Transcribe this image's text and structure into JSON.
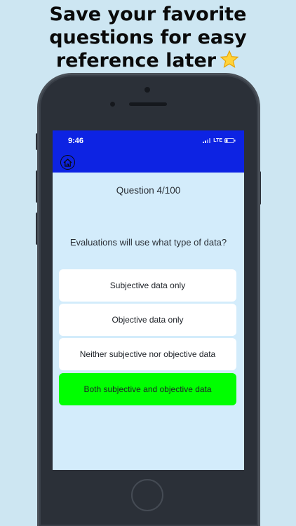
{
  "promo": {
    "headline_line1": "Save your favorite",
    "headline_line2": "questions for easy",
    "headline_line3": "reference later",
    "star_icon": "star-icon"
  },
  "status_bar": {
    "time": "9:46",
    "network": "LTE",
    "background_color": "#0d23e3"
  },
  "nav": {
    "home_icon": "home-icon"
  },
  "quiz": {
    "counter": "Question 4/100",
    "question": "Evaluations will use what type of data?",
    "answers": [
      {
        "label": "Subjective data only",
        "state": "default"
      },
      {
        "label": "Objective data only",
        "state": "default"
      },
      {
        "label": "Neither subjective nor objective data",
        "state": "default"
      },
      {
        "label": "Both subjective and objective data",
        "state": "correct"
      }
    ],
    "correct_color": "#00ff00",
    "screen_background": "#d3ecfb"
  }
}
